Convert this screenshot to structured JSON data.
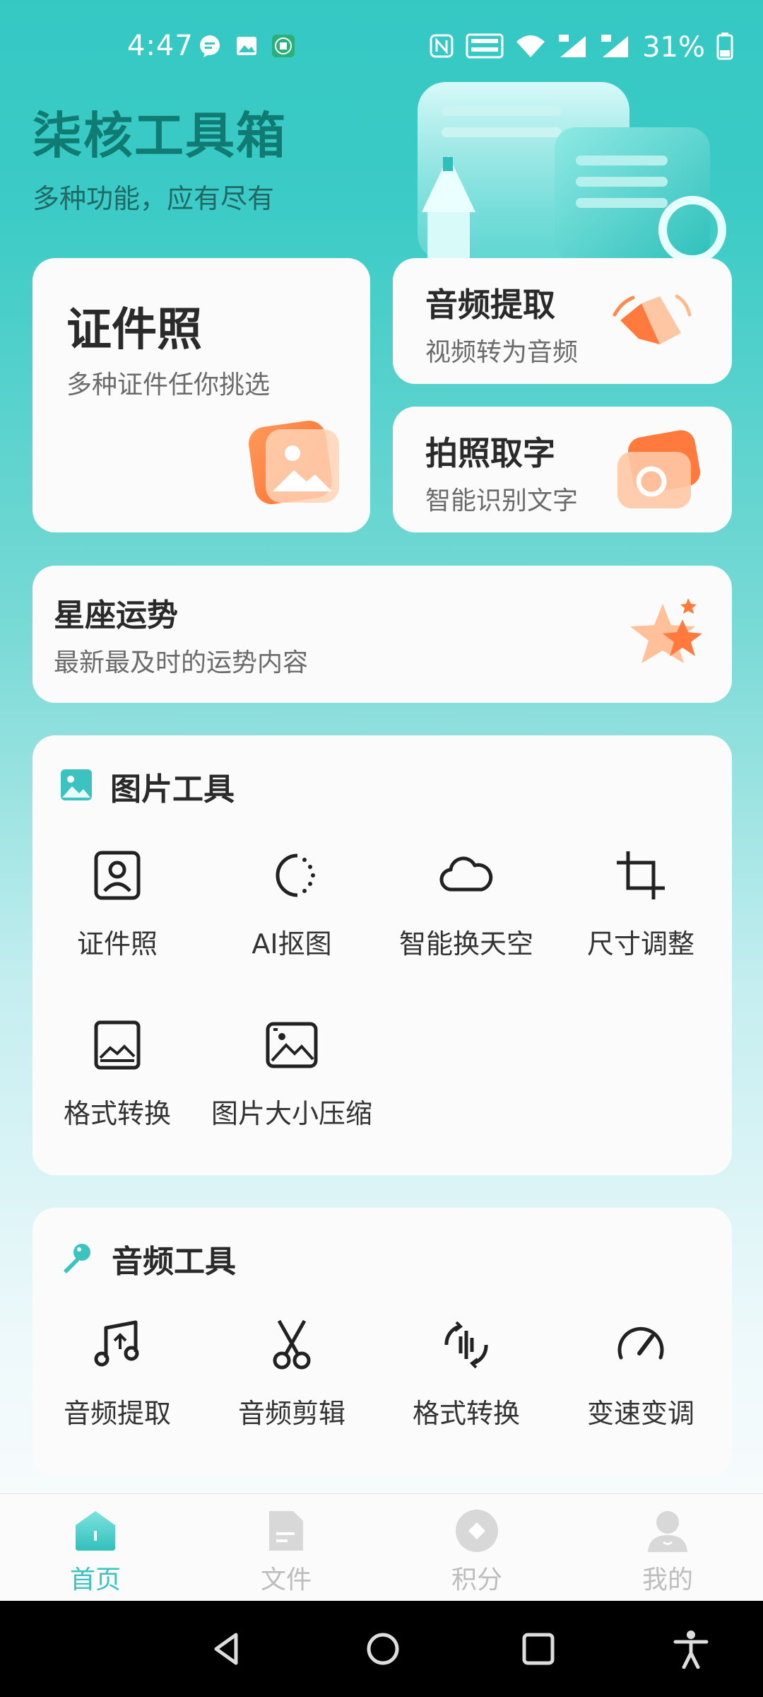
{
  "status_bar": {
    "time": "4:47",
    "battery": "31%",
    "left_icons": [
      "chat-bubble-icon",
      "image-notification-icon",
      "ting-app-icon"
    ],
    "right_icons": [
      "nfc-icon",
      "volte-icon",
      "wifi-icon",
      "4g-signal-icon",
      "4g-signal-icon",
      "battery-icon"
    ]
  },
  "header": {
    "title": "柒核工具箱",
    "subtitle": "多种功能，应有尽有"
  },
  "feature_cards": {
    "id_photo": {
      "title": "证件照",
      "subtitle": "多种证件任你挑选"
    },
    "audio_extract": {
      "title": "音频提取",
      "subtitle": "视频转为音频"
    },
    "photo_ocr": {
      "title": "拍照取字",
      "subtitle": "智能识别文字"
    },
    "horoscope": {
      "title": "星座运势",
      "subtitle": "最新最及时的运势内容"
    }
  },
  "image_tools": {
    "title": "图片工具",
    "items": [
      {
        "label": "证件照",
        "icon": "id-portrait-icon"
      },
      {
        "label": "AI抠图",
        "icon": "ai-cutout-icon"
      },
      {
        "label": "智能换天空",
        "icon": "cloud-icon"
      },
      {
        "label": "尺寸调整",
        "icon": "crop-icon"
      },
      {
        "label": "格式转换",
        "icon": "image-format-icon"
      },
      {
        "label": "图片大小压缩",
        "icon": "image-compress-icon"
      }
    ]
  },
  "audio_tools": {
    "title": "音频工具",
    "items": [
      {
        "label": "音频提取",
        "icon": "music-note-icon"
      },
      {
        "label": "音频剪辑",
        "icon": "scissors-icon"
      },
      {
        "label": "格式转换",
        "icon": "audio-convert-icon"
      },
      {
        "label": "变速变调",
        "icon": "speedometer-icon"
      }
    ]
  },
  "tab_bar": {
    "tabs": [
      {
        "label": "首页",
        "active": true
      },
      {
        "label": "文件",
        "active": false
      },
      {
        "label": "积分",
        "active": false
      },
      {
        "label": "我的",
        "active": false
      }
    ]
  },
  "colors": {
    "brand": "#3cc3bf",
    "accent_orange": "#ff8a4c",
    "title_teal": "#0f7b72"
  }
}
